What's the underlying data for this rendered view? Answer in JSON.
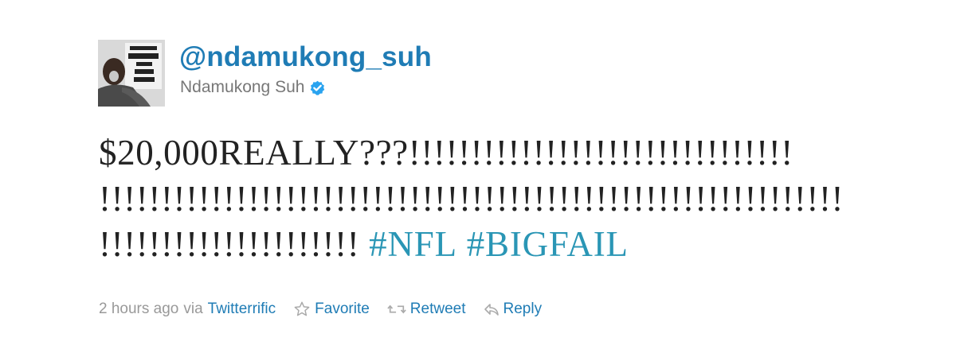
{
  "tweet": {
    "handle": "@ndamukong_suh",
    "display_name": "Ndamukong Suh",
    "avatar_text": "BE THE HAMMER OR THE NAIL",
    "text_line_1": "$20,000REALLY???!!!!!!!!!!!!!!!!!!!!!!!!!!!!!!!",
    "text_line_2": "!!!!!!!!!!!!!!!!!!!!!!!!!!!!!!!!!!!!!!!!!!!!!!!!!!!!!!!!!!!!",
    "text_line_3": "!!!!!!!!!!!!!!!!!!!!!",
    "hashtags": [
      "#NFL",
      "#BIGFAIL"
    ]
  },
  "meta": {
    "time": "2 hours ago",
    "via": "via",
    "client": "Twitterrific",
    "favorite": "Favorite",
    "retweet": "Retweet",
    "reply": "Reply"
  },
  "colors": {
    "link": "#1f7cb5",
    "hashtag": "#2a96b5",
    "text": "#222222",
    "muted": "#999999",
    "verified": "#2aa3ef"
  },
  "icons": {
    "verified": "verified-badge-icon",
    "favorite": "star-icon",
    "retweet": "retweet-icon",
    "reply": "reply-arrow-icon"
  }
}
